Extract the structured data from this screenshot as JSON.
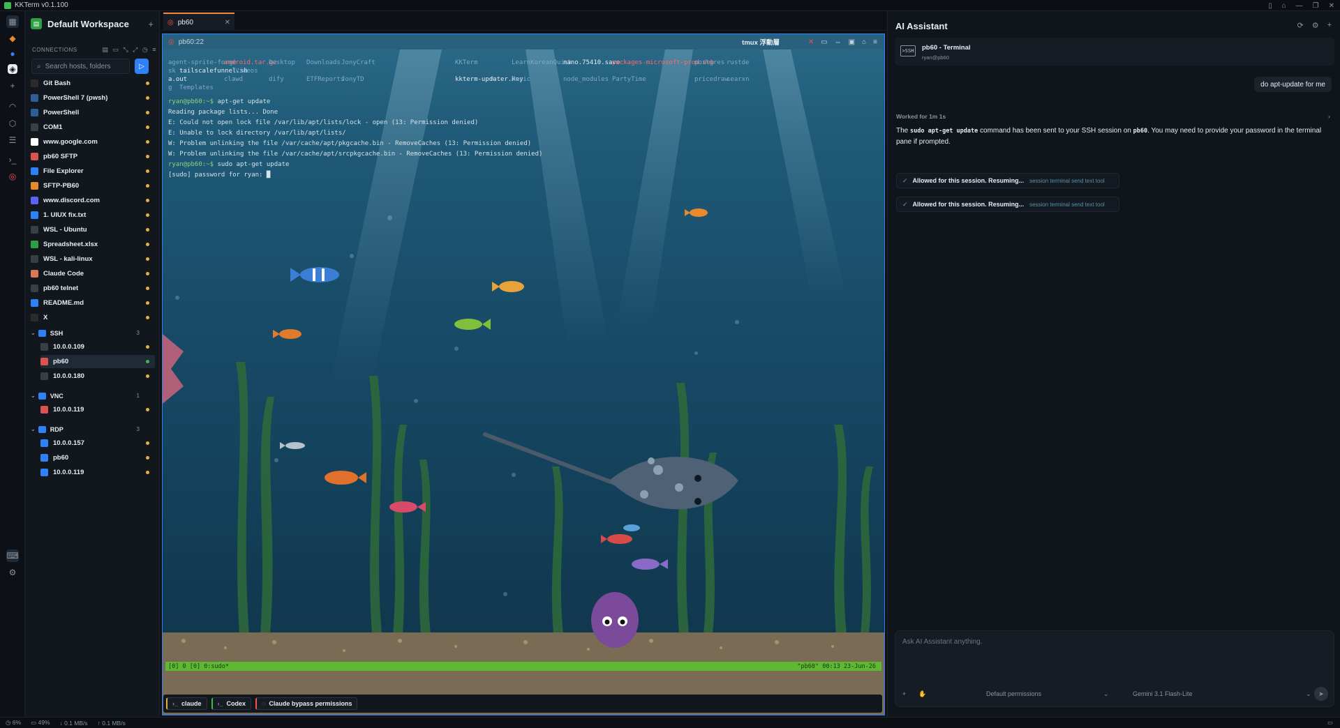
{
  "window": {
    "title": "KKTerm v0.1.100"
  },
  "workspace": {
    "name": "Default Workspace"
  },
  "connections": {
    "header": "CONNECTIONS",
    "search_placeholder": "Search hosts, folders",
    "hosts": [
      {
        "label": "Git Bash",
        "icon": "git-bash-icon",
        "color": "#2b2b2b"
      },
      {
        "label": "PowerShell 7 (pwsh)",
        "icon": "powershell-icon",
        "color": "#2f5d9a"
      },
      {
        "label": "PowerShell",
        "icon": "powershell-icon",
        "color": "#2f5d9a"
      },
      {
        "label": "COM1",
        "icon": "serial-icon",
        "color": "#3a3f46"
      },
      {
        "label": "www.google.com",
        "icon": "google-icon",
        "color": "#ffffff"
      },
      {
        "label": "pb60 SFTP",
        "icon": "sftp-icon",
        "color": "#d9534f"
      },
      {
        "label": "File Explorer",
        "icon": "folder-icon",
        "color": "#2f81f7"
      },
      {
        "label": "SFTP-PB60",
        "icon": "folder-icon",
        "color": "#e38b2c"
      },
      {
        "label": "www.discord.com",
        "icon": "discord-icon",
        "color": "#5865f2"
      },
      {
        "label": "1. UIUX fix.txt",
        "icon": "file-icon",
        "color": "#2f81f7"
      },
      {
        "label": "WSL - Ubuntu",
        "icon": "terminal-icon",
        "color": "#3a3f46"
      },
      {
        "label": "Spreadsheet.xlsx",
        "icon": "spreadsheet-icon",
        "color": "#2ea043"
      },
      {
        "label": "WSL - kali-linux",
        "icon": "kali-icon",
        "color": "#3a3f46"
      },
      {
        "label": "Claude Code",
        "icon": "claude-icon",
        "color": "#d97757"
      },
      {
        "label": "pb60 telnet",
        "icon": "telnet-icon",
        "color": "#3a3f46"
      },
      {
        "label": "README.md",
        "icon": "info-icon",
        "color": "#2f81f7"
      },
      {
        "label": "X",
        "icon": "x-icon",
        "color": "#2b2b2b"
      }
    ],
    "folders": [
      {
        "label": "SSH",
        "count": "3",
        "items": [
          "10.0.0.109",
          "pb60",
          "10.0.0.180"
        ]
      },
      {
        "label": "VNC",
        "count": "1",
        "items": [
          "10.0.0.119"
        ]
      },
      {
        "label": "RDP",
        "count": "3",
        "items": [
          "10.0.0.157",
          "pb60",
          "10.0.0.119"
        ]
      }
    ]
  },
  "tab": {
    "label": "pb60"
  },
  "pane": {
    "title": "pb60:22",
    "tmux_label": "tmux 浮動層",
    "ls_rows": [
      [
        "agent-sprite-forge",
        "android.tar.gz",
        "Desktop",
        "Downloads",
        "JonyCraft",
        "",
        "KKTerm",
        "LearnKoreanQuick",
        "nano.75410.save",
        "packages-microsoft-prod.deb",
        "postgres",
        "rustde"
      ],
      [
        "sk",
        "tailscalefunnel.sh",
        "Videos"
      ],
      [
        "a.out",
        "clawd",
        "dify",
        "ETFReports",
        "JonyTD",
        "",
        "kkterm-updater.key",
        "Music",
        "node_modules",
        "PartyTime",
        "pricedraw",
        "searxn"
      ],
      [
        "g",
        "Templates"
      ]
    ],
    "lines": [
      {
        "prompt": "ryan@pb60:~$",
        "text": " apt-get update"
      },
      {
        "prompt": "",
        "text": "Reading package lists... Done"
      },
      {
        "prompt": "",
        "text": "E: Could not open lock file /var/lib/apt/lists/lock - open (13: Permission denied)"
      },
      {
        "prompt": "",
        "text": "E: Unable to lock directory /var/lib/apt/lists/"
      },
      {
        "prompt": "",
        "text": "W: Problem unlinking the file /var/cache/apt/pkgcache.bin - RemoveCaches (13: Permission denied)"
      },
      {
        "prompt": "",
        "text": "W: Problem unlinking the file /var/cache/apt/srcpkgcache.bin - RemoveCaches (13: Permission denied)"
      },
      {
        "prompt": "ryan@pb60:~$",
        "text": " sudo apt-get update"
      },
      {
        "prompt": "",
        "text": "[sudo] password for ryan: █"
      }
    ],
    "status_left": "[0] 0 [0] 0:sudo*",
    "status_right": "\"pb60\" 00:13 23-Jun-26"
  },
  "shortcuts": [
    {
      "label": "claude",
      "icon": "terminal-prompt-icon",
      "color": "#e3b341"
    },
    {
      "label": "Codex",
      "icon": "terminal-prompt-icon",
      "color": "#3fb950"
    },
    {
      "label": "Claude bypass permissions",
      "icon": "shield-icon",
      "color": "#f85149"
    }
  ],
  "ai": {
    "title": "AI Assistant",
    "session": {
      "name": "pb60 - Terminal",
      "user": "ryan@pb60",
      "badge": ">SSH"
    },
    "user_message": "do apt-update for me",
    "worked": "Worked for 1m 1s",
    "reply_pre": "The ",
    "reply_code1": "sudo apt-get update",
    "reply_mid": " command has been sent to your SSH session on ",
    "reply_code2": "pb60",
    "reply_post": ". You may need to provide your password in the terminal pane if prompted.",
    "tool_calls": [
      {
        "label": "Allowed for this session. Resuming...",
        "tool": "session terminal send text tool"
      },
      {
        "label": "Allowed for this session. Resuming...",
        "tool": "session terminal send text tool"
      }
    ],
    "composer_placeholder": "Ask AI Assistant anything.",
    "permissions": "Default permissions",
    "model": "Gemini 3.1 Flash-Lite"
  },
  "statusbar": {
    "cpu": "6%",
    "mem": "49%",
    "down": "0.1 MB/s",
    "up": "0.1 MB/s"
  },
  "colors": {
    "accent": "#2f81f7",
    "online": "#3fb950",
    "idle": "#e3b341",
    "tmux_bar": "#5fb832"
  }
}
